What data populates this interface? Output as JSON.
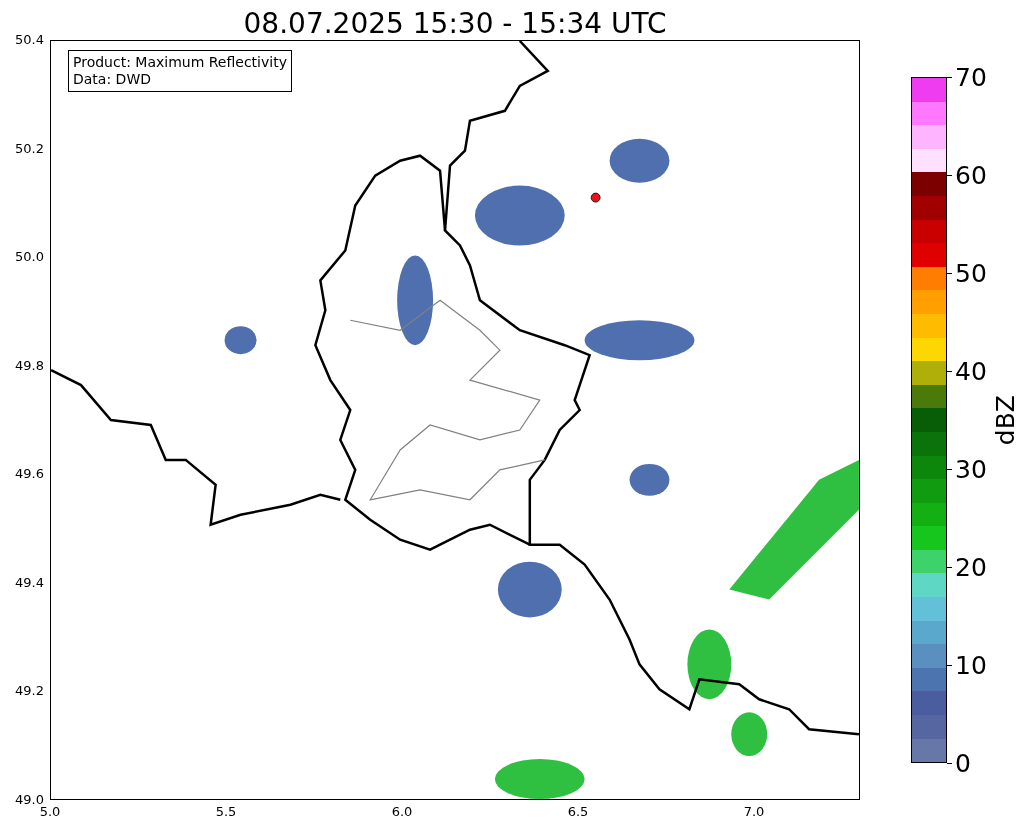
{
  "title": "08.07.2025 15:30 - 15:34 UTC",
  "map": {
    "info_box": [
      "Product: Maximum Reflectivity",
      "Data: DWD"
    ],
    "yticks": [
      "50.4",
      "50.2",
      "50.0",
      "49.8",
      "49.6",
      "49.4",
      "49.2",
      "49.0"
    ],
    "xticks": [
      "5.0",
      "5.5",
      "6.0",
      "6.5",
      "7.0"
    ]
  },
  "colorbar": {
    "label": "dBZ",
    "ticks": [
      "70",
      "60",
      "50",
      "40",
      "30",
      "20",
      "10",
      "0"
    ],
    "segments": [
      {
        "color": "#f03cf0"
      },
      {
        "color": "#ff78ff"
      },
      {
        "color": "#ffb4ff"
      },
      {
        "color": "#ffe0ff"
      },
      {
        "color": "#7d0000"
      },
      {
        "color": "#a00000"
      },
      {
        "color": "#c80000"
      },
      {
        "color": "#e10000"
      },
      {
        "color": "#ff7d00"
      },
      {
        "color": "#ffa000"
      },
      {
        "color": "#ffbb00"
      },
      {
        "color": "#ffd700"
      },
      {
        "color": "#afaf0a"
      },
      {
        "color": "#4a7a0a"
      },
      {
        "color": "#075e07"
      },
      {
        "color": "#0a740a"
      },
      {
        "color": "#0c870c"
      },
      {
        "color": "#0f9c0f"
      },
      {
        "color": "#12b012"
      },
      {
        "color": "#16c61c"
      },
      {
        "color": "#3ed26c"
      },
      {
        "color": "#5ed8c4"
      },
      {
        "color": "#62c0d8"
      },
      {
        "color": "#5aa8cc"
      },
      {
        "color": "#5a90c0"
      },
      {
        "color": "#4c75b0"
      },
      {
        "color": "#4a5d9e"
      },
      {
        "color": "#5666a0"
      },
      {
        "color": "#6677a8"
      }
    ]
  }
}
